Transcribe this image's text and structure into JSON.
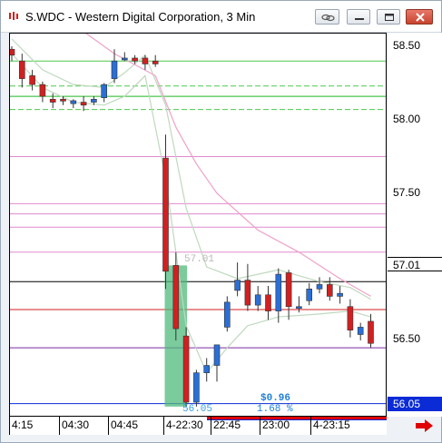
{
  "window": {
    "title": "S.WDC - Western Digital Corporation, 3 Min"
  },
  "titlebar_buttons": [
    "link-icon",
    "minimize-icon",
    "restore-icon",
    "close-icon"
  ],
  "price_axis": {
    "ticks": [
      "58.50",
      "58.00",
      "57.50",
      "57.00",
      "56.50"
    ],
    "current_price": "57.01",
    "low_price": "56.05"
  },
  "time_axis": {
    "labels": [
      "4:15",
      "04:30",
      "04:45",
      "4-22:30",
      "22:45",
      "23:00",
      "4-23:15"
    ]
  },
  "annotations": {
    "range_top_label": "57.01",
    "range_bottom_label": "56.05",
    "change_dollar": "$0.96",
    "change_percent": "1.68 %"
  },
  "colors": {
    "up_candle": "#2a6fd6",
    "down_candle": "#d22020",
    "range_box": "#4fb97b",
    "last_price_line": "#000000",
    "low_line": "#0a2bd6"
  },
  "chart_data": {
    "type": "candlestick",
    "interval": "3 Min",
    "ylim": [
      56.05,
      58.6
    ],
    "x_labels": [
      "4:15",
      "04:30",
      "04:45",
      "4-22:30",
      "22:45",
      "23:00",
      "4-23:15"
    ],
    "candles": [
      {
        "o": 58.48,
        "h": 58.5,
        "c": 58.44,
        "l": 58.4
      },
      {
        "o": 58.4,
        "h": 58.45,
        "c": 58.28,
        "l": 58.22
      },
      {
        "o": 58.3,
        "h": 58.34,
        "c": 58.24,
        "l": 58.2
      },
      {
        "o": 58.24,
        "h": 58.26,
        "c": 58.16,
        "l": 58.12
      },
      {
        "o": 58.14,
        "h": 58.18,
        "c": 58.12,
        "l": 58.08
      },
      {
        "o": 58.14,
        "h": 58.16,
        "c": 58.13,
        "l": 58.1
      },
      {
        "o": 58.11,
        "h": 58.14,
        "c": 58.13,
        "l": 58.08
      },
      {
        "o": 58.12,
        "h": 58.16,
        "c": 58.1,
        "l": 58.06
      },
      {
        "o": 58.12,
        "h": 58.16,
        "c": 58.14,
        "l": 58.1
      },
      {
        "o": 58.15,
        "h": 58.25,
        "c": 58.24,
        "l": 58.12
      },
      {
        "o": 58.28,
        "h": 58.48,
        "c": 58.4,
        "l": 58.25
      },
      {
        "o": 58.42,
        "h": 58.46,
        "c": 58.42,
        "l": 58.4
      },
      {
        "o": 58.42,
        "h": 58.44,
        "c": 58.4,
        "l": 58.38
      },
      {
        "o": 58.42,
        "h": 58.44,
        "c": 58.38,
        "l": 58.34
      },
      {
        "o": 58.4,
        "h": 58.44,
        "c": 58.38,
        "l": 58.36
      },
      {
        "o": 57.74,
        "h": 57.9,
        "c": 56.97,
        "l": 56.85
      },
      {
        "o": 57.01,
        "h": 57.1,
        "c": 56.58,
        "l": 56.5
      },
      {
        "o": 56.53,
        "h": 56.59,
        "c": 56.08,
        "l": 56.05
      },
      {
        "o": 56.08,
        "h": 56.3,
        "c": 56.28,
        "l": 56.05
      },
      {
        "o": 56.28,
        "h": 56.38,
        "c": 56.33,
        "l": 56.22
      },
      {
        "o": 56.33,
        "h": 56.46,
        "c": 56.47,
        "l": 56.22
      },
      {
        "o": 56.59,
        "h": 56.8,
        "c": 56.76,
        "l": 56.56
      },
      {
        "o": 56.84,
        "h": 57.03,
        "c": 56.91,
        "l": 56.8
      },
      {
        "o": 56.91,
        "h": 57.02,
        "c": 56.74,
        "l": 56.7
      },
      {
        "o": 56.74,
        "h": 56.87,
        "c": 56.81,
        "l": 56.7
      },
      {
        "o": 56.81,
        "h": 56.87,
        "c": 56.7,
        "l": 56.64
      },
      {
        "o": 56.7,
        "h": 56.99,
        "c": 56.95,
        "l": 56.62
      },
      {
        "o": 56.96,
        "h": 56.98,
        "c": 56.73,
        "l": 56.64
      },
      {
        "o": 56.73,
        "h": 56.8,
        "c": 56.73,
        "l": 56.69
      },
      {
        "o": 56.77,
        "h": 56.89,
        "c": 56.85,
        "l": 56.74
      },
      {
        "o": 56.85,
        "h": 56.93,
        "c": 56.88,
        "l": 56.82
      },
      {
        "o": 56.88,
        "h": 56.93,
        "c": 56.8,
        "l": 56.77
      },
      {
        "o": 56.8,
        "h": 56.87,
        "c": 56.82,
        "l": 56.75
      },
      {
        "o": 56.73,
        "h": 56.78,
        "c": 56.57,
        "l": 56.52
      },
      {
        "o": 56.54,
        "h": 56.62,
        "c": 56.59,
        "l": 56.5
      },
      {
        "o": 56.63,
        "h": 56.68,
        "c": 56.48,
        "l": 56.45
      }
    ],
    "horizontal_levels": [
      {
        "price": 58.4,
        "color": "#4cc94c"
      },
      {
        "price": 58.23,
        "color": "#4cc94c",
        "dash": true
      },
      {
        "price": 58.16,
        "color": "#22b822"
      },
      {
        "price": 58.07,
        "color": "#4cc94c",
        "dash": true
      },
      {
        "price": 57.75,
        "color": "#e08ad0"
      },
      {
        "price": 57.43,
        "color": "#e08ad0"
      },
      {
        "price": 57.36,
        "color": "#e08ad0"
      },
      {
        "price": 57.27,
        "color": "#e08ad0"
      },
      {
        "price": 57.1,
        "color": "#e08ad0"
      },
      {
        "price": 56.9,
        "color": "#000000"
      },
      {
        "price": 56.71,
        "color": "#d22020"
      },
      {
        "price": 56.45,
        "color": "#7a2aa0"
      },
      {
        "price": 56.07,
        "color": "#0a2bd6"
      }
    ],
    "range_box": {
      "start_index": 15,
      "end_index": 17,
      "high": 57.01,
      "low": 56.05
    },
    "pink_curve": [
      [
        0,
        58.95
      ],
      [
        10,
        58.45
      ],
      [
        14,
        58.3
      ],
      [
        16,
        57.95
      ],
      [
        18,
        57.7
      ],
      [
        20,
        57.5
      ],
      [
        24,
        57.25
      ],
      [
        28,
        57.1
      ],
      [
        32,
        56.92
      ],
      [
        35,
        56.8
      ]
    ],
    "band_upper": [
      [
        0,
        58.55
      ],
      [
        3,
        58.34
      ],
      [
        6,
        58.24
      ],
      [
        9,
        58.22
      ],
      [
        11,
        58.32
      ],
      [
        13,
        58.44
      ],
      [
        15,
        58.1
      ],
      [
        17,
        57.4
      ],
      [
        19,
        57.0
      ],
      [
        22,
        56.92
      ],
      [
        26,
        56.98
      ],
      [
        30,
        56.9
      ],
      [
        33,
        56.86
      ],
      [
        35,
        56.78
      ]
    ],
    "band_lower": [
      [
        0,
        58.45
      ],
      [
        3,
        58.22
      ],
      [
        6,
        58.12
      ],
      [
        9,
        58.1
      ],
      [
        11,
        58.16
      ],
      [
        13,
        58.3
      ],
      [
        15,
        57.6
      ],
      [
        17,
        56.6
      ],
      [
        19,
        56.28
      ],
      [
        21,
        56.45
      ],
      [
        23,
        56.6
      ],
      [
        26,
        56.66
      ],
      [
        30,
        56.68
      ],
      [
        33,
        56.7
      ],
      [
        35,
        56.66
      ]
    ]
  }
}
